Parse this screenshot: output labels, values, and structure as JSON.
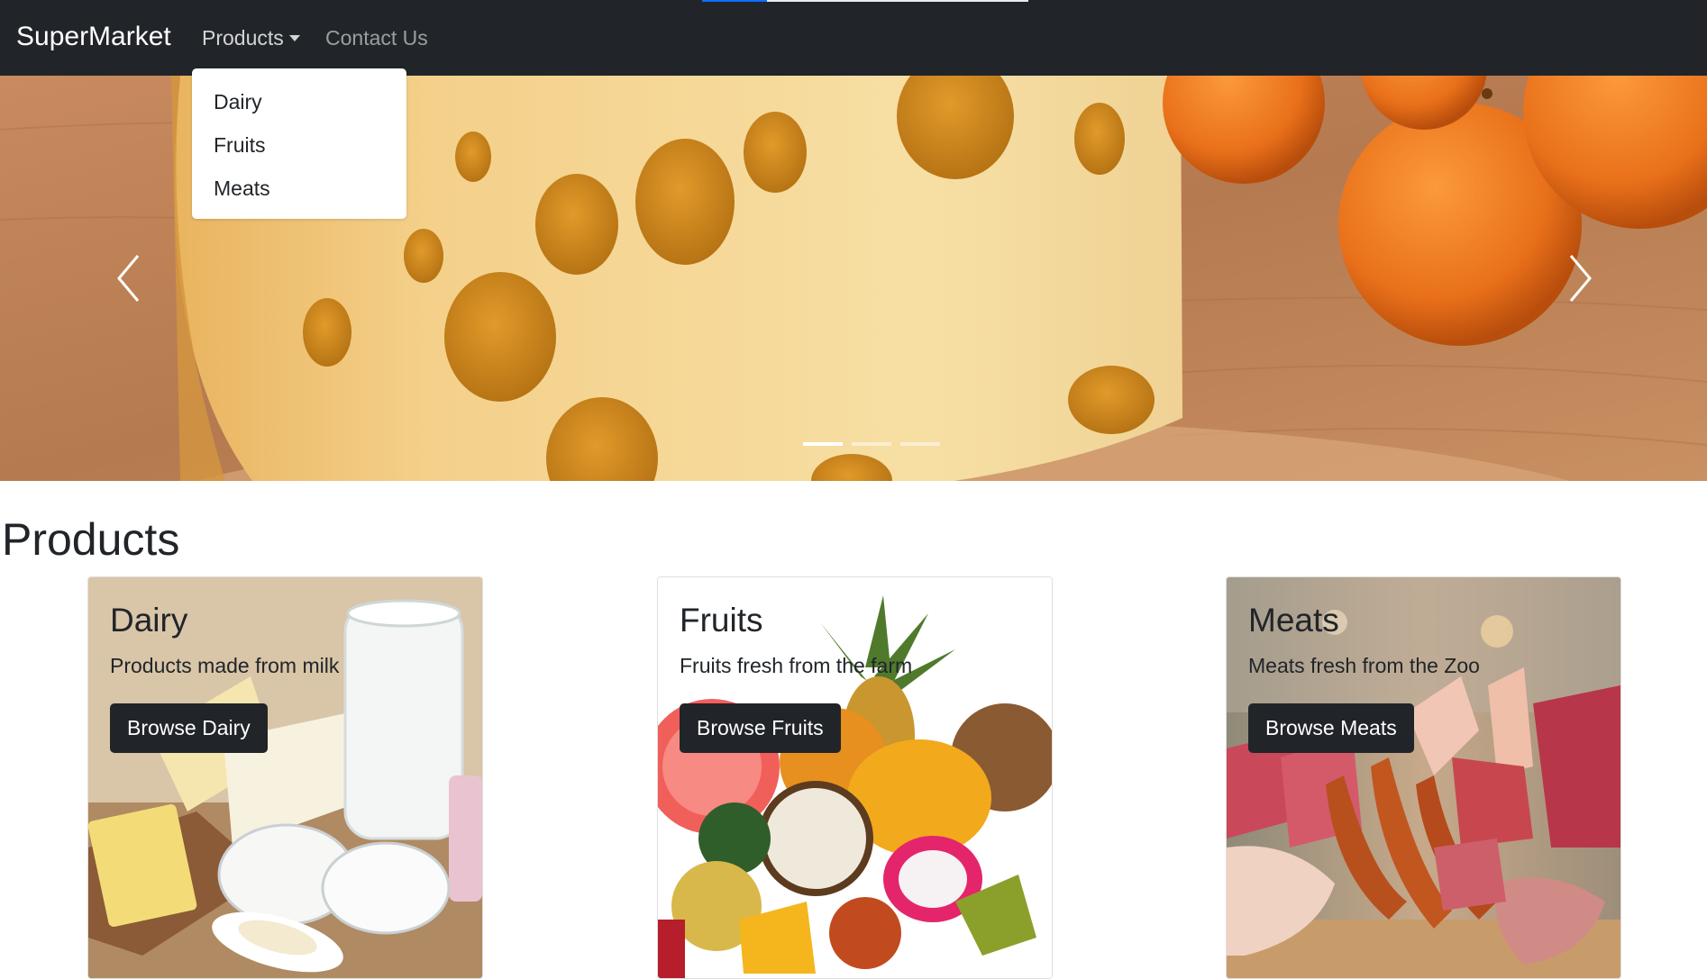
{
  "navbar": {
    "brand": "SuperMarket",
    "products_label": "Products",
    "contact_label": "Contact Us",
    "page_load_progress": 0.2,
    "dropdown_items": [
      {
        "label": "Dairy"
      },
      {
        "label": "Fruits"
      },
      {
        "label": "Meats"
      }
    ]
  },
  "carousel": {
    "slide_count": 3,
    "active_index": 0
  },
  "products": {
    "title": "Products",
    "cards": [
      {
        "title": "Dairy",
        "text": "Products made from milk",
        "button": "Browse Dairy"
      },
      {
        "title": "Fruits",
        "text": "Fruits fresh from the farm",
        "button": "Browse Fruits"
      },
      {
        "title": "Meats",
        "text": "Meats fresh from the Zoo",
        "button": "Browse Meats"
      }
    ]
  },
  "colors": {
    "navbar_bg": "#212529",
    "progress": "#0d6efd",
    "button_bg": "#212529"
  }
}
